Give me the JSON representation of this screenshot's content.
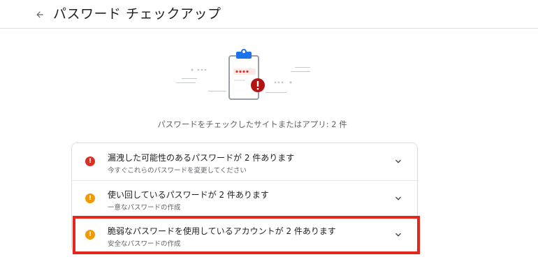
{
  "header": {
    "title": "パスワード チェックアップ",
    "back_icon": "arrow-back-icon"
  },
  "summary": "パスワードをチェックしたサイトまたはアプリ: 2 件",
  "issues": [
    {
      "title": "漏洩した可能性のあるパスワードが 2 件あります",
      "subtitle": "今すぐこれらのパスワードを変更してください",
      "severity_color": "#d93025",
      "icon": "alert-error-icon"
    },
    {
      "title": "使い回しているパスワードが 2 件あります",
      "subtitle": "一意なパスワードの作成",
      "severity_color": "#f29900",
      "icon": "alert-warning-icon"
    },
    {
      "title": "脆弱なパスワードを使用しているアカウントが 2 件あります",
      "subtitle": "安全なパスワードの作成",
      "severity_color": "#f29900",
      "icon": "alert-warning-icon"
    }
  ],
  "highlight_color": "#e5261c"
}
